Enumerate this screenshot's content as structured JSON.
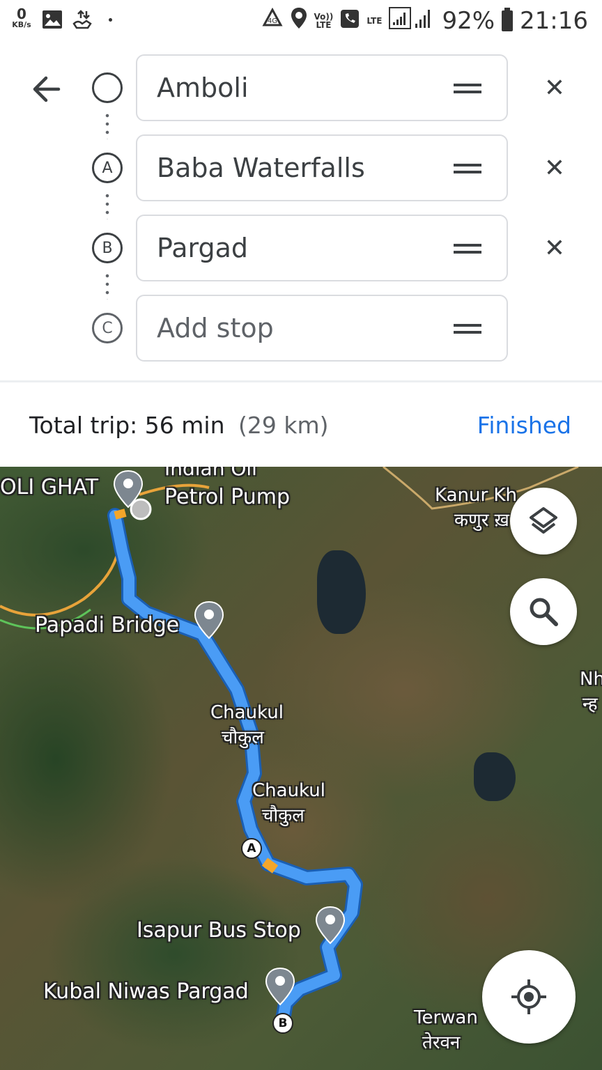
{
  "status_bar": {
    "speed_value": "0",
    "speed_unit": "KB/s",
    "volte_top": "Vo))",
    "volte_bottom": "LTE",
    "lte_label": "LTE",
    "battery": "92%",
    "time": "21:16",
    "icons": [
      "image-icon",
      "data-transfer-icon",
      "recycle-icon",
      "location-icon",
      "phone-icon",
      "signal-icon",
      "battery-icon"
    ]
  },
  "route": {
    "origin": {
      "value": "Amboli"
    },
    "stops": [
      {
        "marker": "A",
        "value": "Baba Waterfalls"
      },
      {
        "marker": "B",
        "value": "Pargad"
      }
    ],
    "add_stop": {
      "marker": "C",
      "placeholder": "Add stop"
    }
  },
  "trip": {
    "label": "Total trip: 56 min",
    "distance": "(29 km)",
    "finished_label": "Finished"
  },
  "map": {
    "labels": {
      "oli_ghat": "OLI GHAT",
      "indian_oil": "Indian Oil",
      "petrol_pump": "Petrol Pump",
      "kanur_en": "Kanur Kh",
      "kanur_hi": "कणुर ख़",
      "papadi": "Papadi Bridge",
      "chaukul1_en": "Chaukul",
      "chaukul1_hi": "चौकुल",
      "chaukul2_en": "Chaukul",
      "chaukul2_hi": "चौकुल",
      "isapur": "Isapur Bus Stop",
      "kubal": "Kubal Niwas Pargad",
      "terwan_en": "Terwan",
      "terwan_hi": "तेरवन",
      "nh_en": "Nh",
      "nh_hi": "न्ह"
    },
    "waypoint_a": "A",
    "waypoint_b": "B",
    "route_color": "#4a9cf5"
  }
}
